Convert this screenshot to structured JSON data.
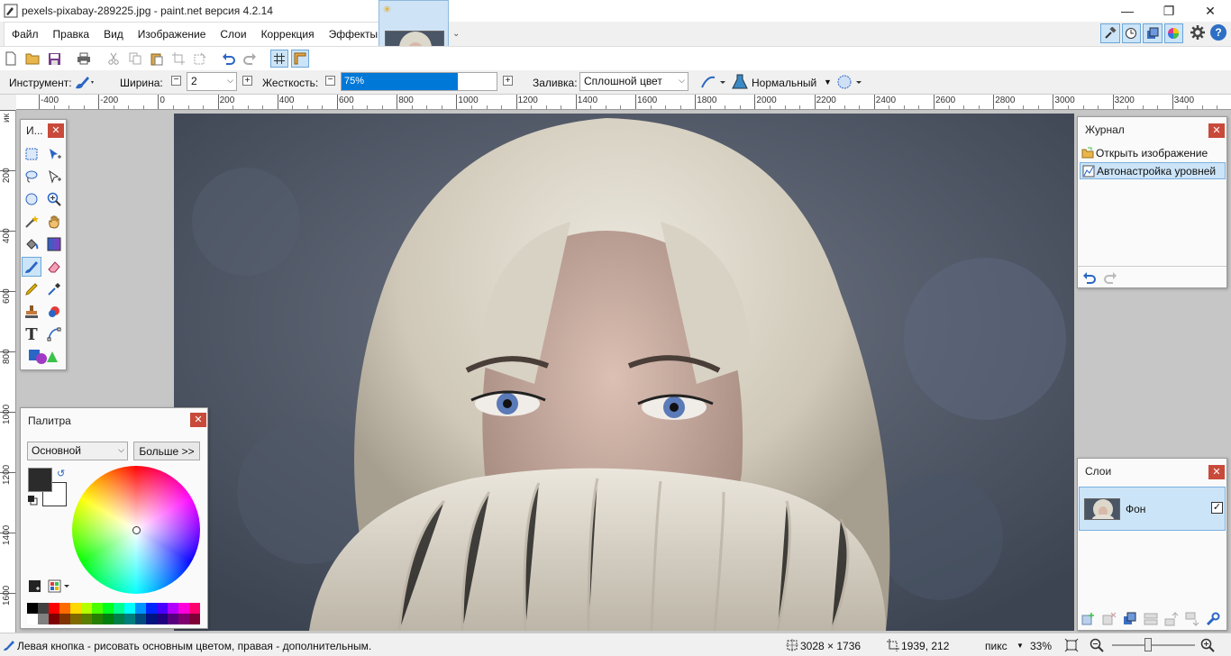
{
  "window": {
    "title": "pexels-pixabay-289225.jpg - paint.net версия 4.2.14",
    "minimize_icon": "minimize-icon",
    "maximize_icon": "restore-icon",
    "close_icon": "close-icon"
  },
  "menu": {
    "items": [
      "Файл",
      "Правка",
      "Вид",
      "Изображение",
      "Слои",
      "Коррекция",
      "Эффекты"
    ]
  },
  "options": {
    "tool_label": "Инструмент:",
    "width_label": "Ширина:",
    "width_value": "2",
    "hardness_label": "Жесткость:",
    "hardness_value": "75%",
    "hardness_fraction": 0.75,
    "fill_label": "Заливка:",
    "fill_value": "Сплошной цвет",
    "blend_value": "Нормальный"
  },
  "ruler": {
    "h_labels": [
      "-400",
      "-200",
      "0",
      "200",
      "400",
      "600",
      "800",
      "1000",
      "1200",
      "1400",
      "1600",
      "1800",
      "2000",
      "2200",
      "2400",
      "2600",
      "2800",
      "3000",
      "3200",
      "3400"
    ],
    "v_labels": [
      "ик",
      "200",
      "400",
      "600",
      "800",
      "1000",
      "1200",
      "1400",
      "1600"
    ]
  },
  "tools_panel": {
    "title": "И..."
  },
  "palette": {
    "title": "Палитра",
    "mode_value": "Основной",
    "more_button": "Больше >>",
    "primary_color": "#2b2b2b",
    "secondary_color": "#ffffff",
    "swatches_row1": [
      "#000000",
      "#404040",
      "#ff0000",
      "#ff6a00",
      "#ffd800",
      "#b6ff00",
      "#4cff00",
      "#00ff21",
      "#00ff90",
      "#00ffff",
      "#0094ff",
      "#0026ff",
      "#4800ff",
      "#b200ff",
      "#ff00dc",
      "#ff006e"
    ],
    "swatches_row2": [
      "#ffffff",
      "#808080",
      "#7f0000",
      "#7f3300",
      "#7f6a00",
      "#5b7f00",
      "#267f00",
      "#007f0e",
      "#007f46",
      "#007f7f",
      "#004a7f",
      "#00137f",
      "#21007f",
      "#57007f",
      "#7f006e",
      "#7f0037"
    ]
  },
  "history": {
    "title": "Журнал",
    "items": [
      {
        "label": "Открыть изображение",
        "selected": false
      },
      {
        "label": "Автонастройка уровней",
        "selected": true
      }
    ]
  },
  "layers": {
    "title": "Слои",
    "items": [
      {
        "label": "Фон",
        "visible": true
      }
    ]
  },
  "status": {
    "hint": "Левая кнопка - рисовать основным цветом, правая - дополнительным.",
    "image_size": "3028 × 1736",
    "cursor_pos": "1939, 212",
    "unit": "пикс",
    "zoom": "33%"
  },
  "colors": {
    "accent": "#0078d7",
    "selection": "#cce4f7",
    "close_red": "#c94a3a"
  }
}
